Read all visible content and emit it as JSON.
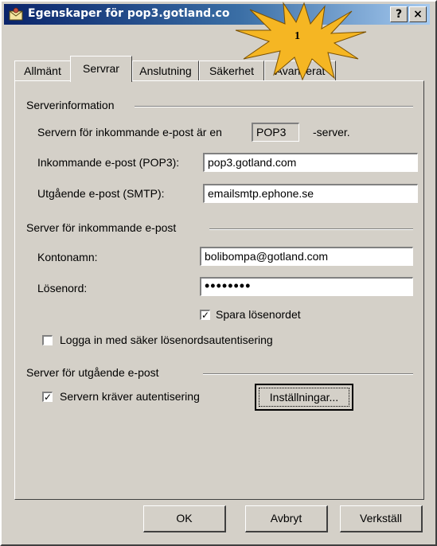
{
  "window": {
    "title": "Egenskaper för pop3.gotland.co",
    "help_btn": "?",
    "close_btn": "×"
  },
  "callout": {
    "number": "1",
    "color": "#f5b623"
  },
  "tabs": [
    {
      "label": "Allmänt",
      "active": false
    },
    {
      "label": "Servrar",
      "active": true
    },
    {
      "label": "Anslutning",
      "active": false
    },
    {
      "label": "Säkerhet",
      "active": false
    },
    {
      "label": "Avancerat",
      "active": false
    }
  ],
  "server_info": {
    "heading": "Serverinformation",
    "incoming_type_prefix": "Servern för inkommande e-post är en",
    "incoming_type_value": "POP3",
    "incoming_type_suffix": "-server.",
    "incoming_label": "Inkommande e-post (POP3):",
    "incoming_value": "pop3.gotland.com",
    "outgoing_label": "Utgående e-post (SMTP):",
    "outgoing_value": "emailsmtp.ephone.se"
  },
  "incoming_server": {
    "heading": "Server för inkommande e-post",
    "account_label": "Kontonamn:",
    "account_value": "bolibompa@gotland.com",
    "password_label": "Lösenord:",
    "password_value": "••••••••",
    "save_password_label": "Spara lösenordet",
    "save_password_checked": true,
    "spa_label": "Logga in med säker lösenordsautentisering",
    "spa_checked": false
  },
  "outgoing_server": {
    "heading": "Server för utgående e-post",
    "auth_label": "Servern kräver autentisering",
    "auth_checked": true,
    "settings_button": "Inställningar..."
  },
  "footer": {
    "ok": "OK",
    "cancel": "Avbryt",
    "apply": "Verkställ"
  },
  "colors": {
    "dialog_bg": "#d4d0c8",
    "titlebar_start": "#0a246a",
    "titlebar_end": "#a6caf0"
  }
}
